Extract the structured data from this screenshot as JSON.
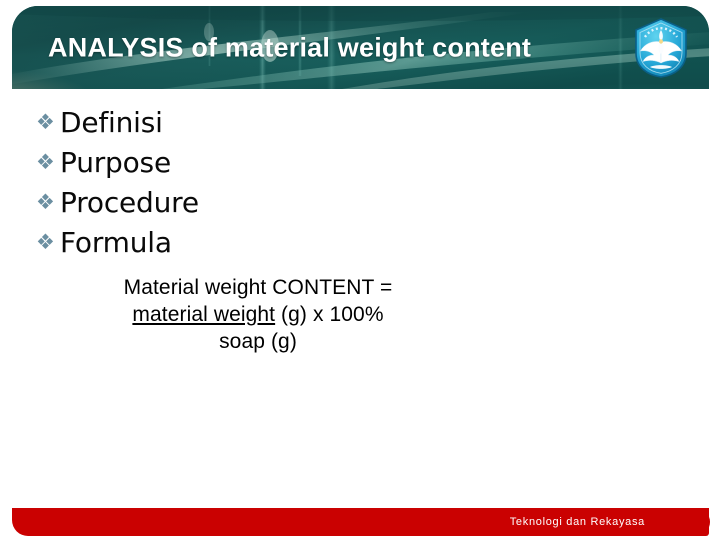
{
  "slide": {
    "background_color": "#ffffff"
  },
  "header": {
    "title": "ANALYSIS of material weight content",
    "banner_color": "#16504f",
    "banner_accent_color": "#2fb3a8",
    "title_color": "#ffffff",
    "logo": {
      "icon": "tut-wuri-handayani-logo",
      "color": "#29a8d8"
    }
  },
  "outline": {
    "bullet_icon": "diamond-cluster-bullet",
    "bullet_glyph": "❖",
    "bullet_color": "#6b8fa1",
    "items": [
      {
        "label": "Definisi"
      },
      {
        "label": "Purpose"
      },
      {
        "label": "Procedure"
      },
      {
        "label": "Formula"
      }
    ]
  },
  "formula": {
    "line1": "Material weight CONTENT =",
    "numerator": "material weight",
    "numerator_suffix": " (g) x 100%",
    "denominator": "soap (g)"
  },
  "footer": {
    "text": "Teknologi dan Rekayasa",
    "bar_color": "#ca0101",
    "text_color": "#ffffff"
  }
}
